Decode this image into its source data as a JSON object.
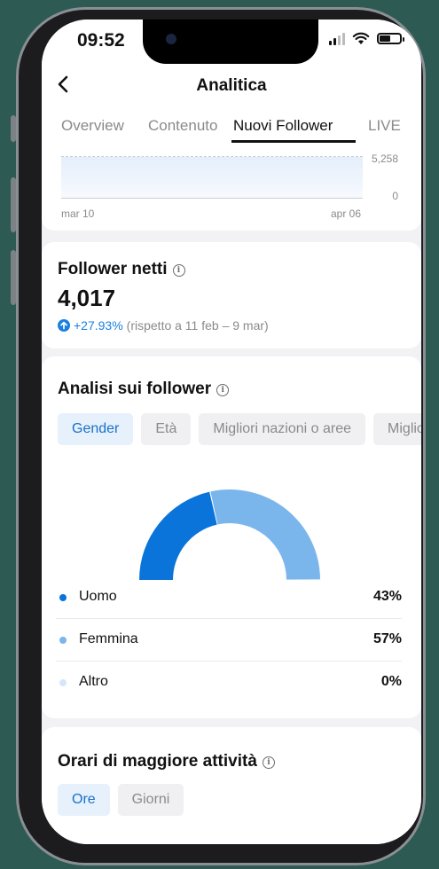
{
  "status": {
    "time": "09:52"
  },
  "nav": {
    "title": "Analitica"
  },
  "tabs": [
    {
      "label": "Overview"
    },
    {
      "label": "Contenuto"
    },
    {
      "label": "Nuovi Follower"
    },
    {
      "label": "LIVE"
    }
  ],
  "top_chart": {
    "y_max_label": "5,258",
    "y_min_label": "0",
    "x_start": "mar 10",
    "x_end": "apr 06"
  },
  "net_followers": {
    "title": "Follower netti",
    "value": "4,017",
    "change": "+27.93%",
    "comparison": "(rispetto a 11 feb – 9 mar)"
  },
  "analysis": {
    "title": "Analisi sui follower",
    "chips": [
      {
        "label": "Gender"
      },
      {
        "label": "Età"
      },
      {
        "label": "Migliori nazioni o aree"
      },
      {
        "label": "Miglio"
      }
    ],
    "legend": [
      {
        "label": "Uomo",
        "value": "43%",
        "color": "#0a74da"
      },
      {
        "label": "Femmina",
        "value": "57%",
        "color": "#7ab6ec"
      },
      {
        "label": "Altro",
        "value": "0%",
        "color": "#d4e7fa"
      }
    ]
  },
  "chart_data": {
    "type": "pie",
    "categories": [
      "Uomo",
      "Femmina",
      "Altro"
    ],
    "values": [
      43,
      57,
      0
    ]
  },
  "activity": {
    "title": "Orari di maggiore attività",
    "chips": [
      {
        "label": "Ore"
      },
      {
        "label": "Giorni"
      }
    ]
  }
}
